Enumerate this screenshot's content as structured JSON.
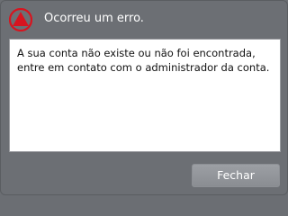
{
  "dialog": {
    "title": "Ocorreu um erro.",
    "icon": "warning-triangle-icon",
    "message": "A sua conta não existe ou não foi encontrada, entre em contato com o administrador da conta.",
    "close_label": "Fechar"
  },
  "colors": {
    "background": "#6c6f74",
    "icon_accent": "#d7141f",
    "button": "#94979c"
  }
}
